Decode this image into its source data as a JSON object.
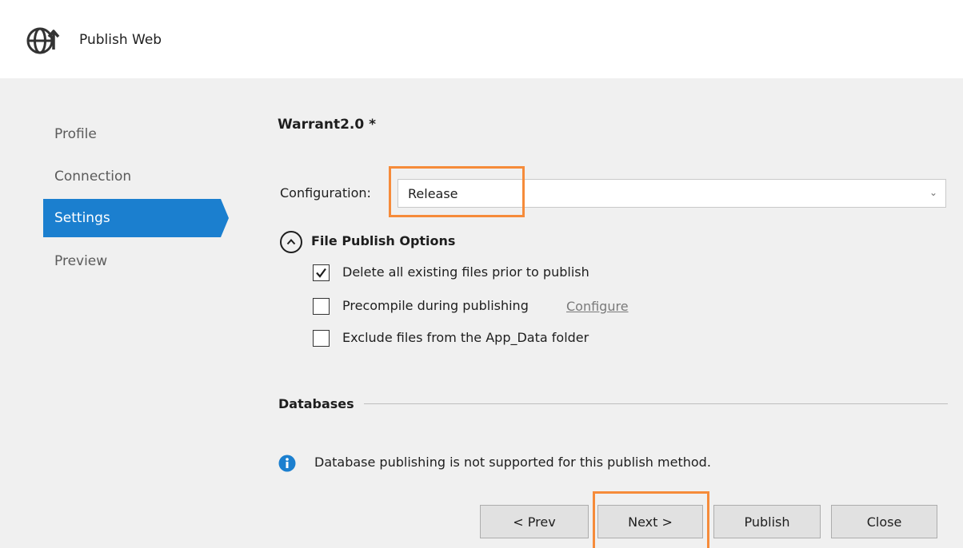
{
  "window": {
    "title": "Publish Web",
    "icon": "globe-publish-icon"
  },
  "sidebar": {
    "items": [
      {
        "label": "Profile",
        "active": false
      },
      {
        "label": "Connection",
        "active": false
      },
      {
        "label": "Settings",
        "active": true
      },
      {
        "label": "Preview",
        "active": false
      }
    ]
  },
  "main": {
    "profile_title": "Warrant2.0 *",
    "configuration": {
      "label": "Configuration:",
      "value": "Release"
    },
    "file_publish_options": {
      "title": "File Publish Options",
      "expanded": true,
      "options": [
        {
          "label": "Delete all existing files prior to publish",
          "checked": true
        },
        {
          "label": "Precompile during publishing",
          "checked": false,
          "link": "Configure"
        },
        {
          "label": "Exclude files from the App_Data folder",
          "checked": false
        }
      ]
    },
    "databases": {
      "title": "Databases",
      "message": "Database publishing is not supported for this publish method."
    }
  },
  "buttons": {
    "prev": "< Prev",
    "next": "Next >",
    "publish": "Publish",
    "close": "Close"
  },
  "colors": {
    "accent": "#1b7fcf",
    "highlight": "#f68b3a",
    "info": "#1b7fcf"
  }
}
